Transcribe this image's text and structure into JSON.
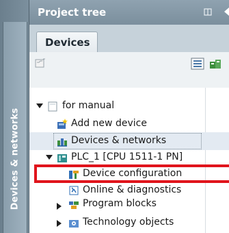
{
  "side_panel": {
    "tab_label": "Devices & networks"
  },
  "panel": {
    "title": "Project tree",
    "devices_tab": "Devices"
  },
  "tree": {
    "items": [
      {
        "label": "for manual",
        "expanded": true
      },
      {
        "label": "Add new device"
      },
      {
        "label": "Devices & networks",
        "selected": true
      },
      {
        "label": "PLC_1 [CPU 1511-1 PN]",
        "expanded": true
      },
      {
        "label": "Device configuration"
      },
      {
        "label": "Online & diagnostics",
        "highlighted": true
      },
      {
        "label": "Program blocks",
        "expanded": false
      },
      {
        "label": "Technology objects",
        "expanded": false
      }
    ]
  },
  "colors": {
    "highlight": "#e0141c",
    "header": "#7b8f9d"
  },
  "icons": [
    "pin-icon",
    "collapse-arrow-icon",
    "project-icon",
    "view-icon",
    "network-icon",
    "folder-icon",
    "add-device-icon",
    "devices-networks-icon",
    "plc-icon",
    "device-config-icon",
    "online-diag-icon",
    "program-blocks-icon",
    "technology-objects-icon"
  ]
}
